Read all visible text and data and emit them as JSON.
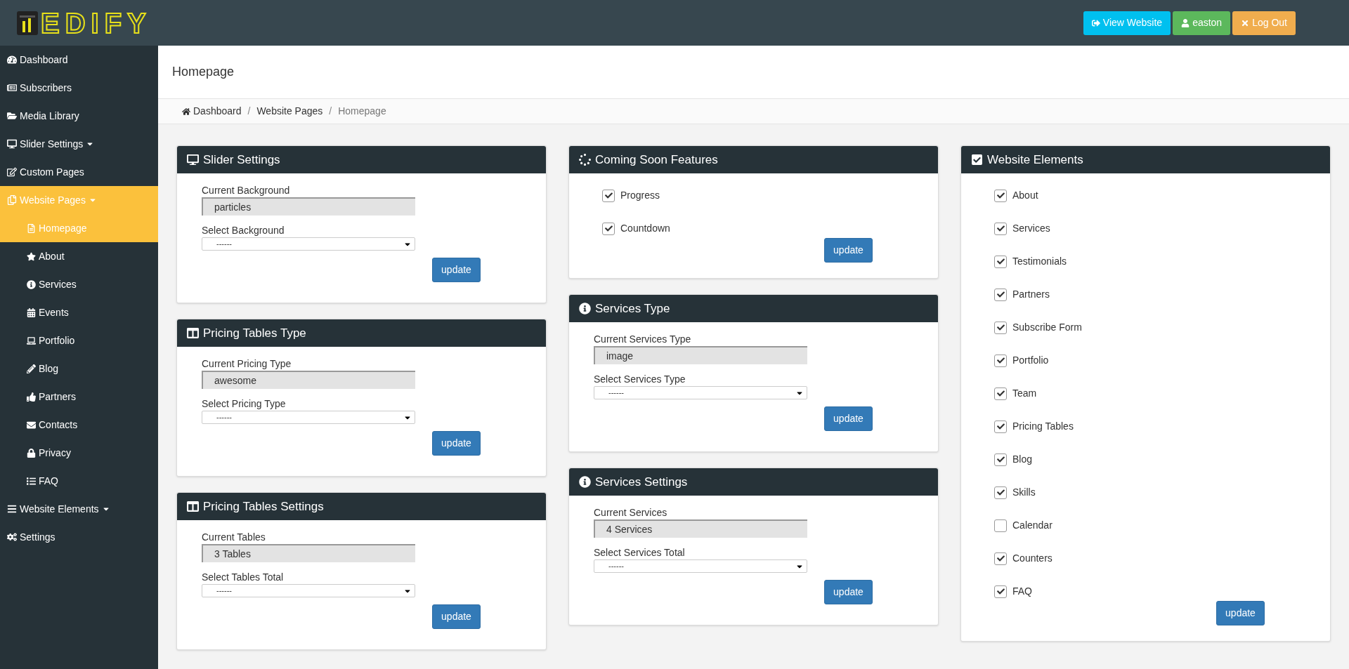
{
  "header": {
    "logo_text": "EDIFY",
    "buttons": [
      {
        "kind": "view",
        "label": "View Website"
      },
      {
        "kind": "user",
        "label": "easton"
      },
      {
        "kind": "logout",
        "label": "Log Out"
      }
    ]
  },
  "sidebar": {
    "items": [
      {
        "label": "Dashboard",
        "selected": false,
        "dropdown": false
      },
      {
        "label": "Subscribers",
        "selected": false,
        "dropdown": false
      },
      {
        "label": "Media Library",
        "selected": false,
        "dropdown": false
      },
      {
        "label": "Slider Settings",
        "selected": false,
        "dropdown": true
      },
      {
        "label": "Custom Pages",
        "selected": false,
        "dropdown": false
      },
      {
        "label": "Website Pages",
        "selected": true,
        "dropdown": true,
        "children": [
          {
            "label": "Homepage",
            "selected": true
          },
          {
            "label": "About",
            "selected": false
          },
          {
            "label": "Services",
            "selected": false
          },
          {
            "label": "Events",
            "selected": false
          },
          {
            "label": "Portfolio",
            "selected": false
          },
          {
            "label": "Blog",
            "selected": false
          },
          {
            "label": "Partners",
            "selected": false
          },
          {
            "label": "Contacts",
            "selected": false
          },
          {
            "label": "Privacy",
            "selected": false
          },
          {
            "label": "FAQ",
            "selected": false
          }
        ]
      },
      {
        "label": "Website Elements",
        "selected": false,
        "dropdown": true
      },
      {
        "label": "Settings",
        "selected": false,
        "dropdown": false
      }
    ]
  },
  "page_title": "Homepage",
  "breadcrumb": [
    {
      "label": "Dashboard"
    },
    {
      "separator": "/",
      "label": "Website Pages"
    },
    {
      "separator": "/",
      "label": "Homepage"
    }
  ],
  "columns": [
    [
      {
        "kind": "select_form",
        "title": "Slider Settings",
        "current_label": "Current Background",
        "current_value": "particles",
        "select_label": "Select Background",
        "select_value": "------",
        "button": "update"
      },
      {
        "kind": "select_form",
        "title": "Pricing Tables Type",
        "current_label": "Current Pricing Type",
        "current_value": "awesome",
        "select_label": "Select Pricing Type",
        "select_value": "------",
        "button": "update"
      },
      {
        "kind": "select_form",
        "title": "Pricing Tables Settings",
        "current_label": "Current Tables",
        "current_value": "3 Tables",
        "select_label": "Select Tables Total",
        "select_value": "------",
        "button": "update"
      }
    ],
    [
      {
        "kind": "checklist",
        "title": "Coming Soon Features",
        "items": [
          {
            "label": "Progress",
            "checked": true
          },
          {
            "label": "Countdown",
            "checked": true
          }
        ],
        "button": "update"
      },
      {
        "kind": "select_form",
        "title": "Services Type",
        "current_label": "Current Services Type",
        "current_value": "image",
        "select_label": "Select Services Type",
        "select_value": "------",
        "button": "update"
      },
      {
        "kind": "select_form",
        "title": "Services Settings",
        "current_label": "Current Services",
        "current_value": "4 Services",
        "select_label": "Select Services Total",
        "select_value": "------",
        "button": "update"
      }
    ],
    [
      {
        "kind": "checklist",
        "title": "Website Elements",
        "items": [
          {
            "label": "About",
            "checked": true
          },
          {
            "label": "Services",
            "checked": true
          },
          {
            "label": "Testimonials",
            "checked": true
          },
          {
            "label": "Partners",
            "checked": true
          },
          {
            "label": "Subscribe Form",
            "checked": true
          },
          {
            "label": "Portfolio",
            "checked": true
          },
          {
            "label": "Team",
            "checked": true
          },
          {
            "label": "Pricing Tables",
            "checked": true
          },
          {
            "label": "Blog",
            "checked": true
          },
          {
            "label": "Skills",
            "checked": true
          },
          {
            "label": "Calendar",
            "checked": false
          },
          {
            "label": "Counters",
            "checked": true
          },
          {
            "label": "FAQ",
            "checked": true
          }
        ],
        "button": "update"
      }
    ]
  ]
}
